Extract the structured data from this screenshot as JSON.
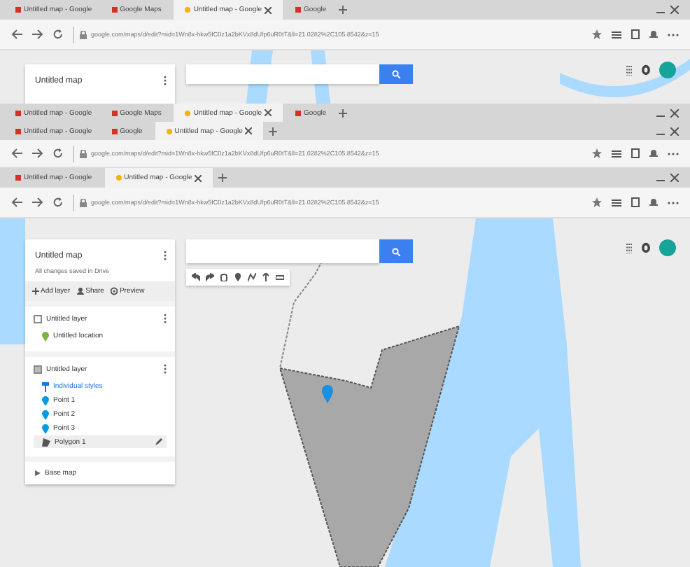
{
  "windows": [
    {
      "tabs": [
        {
          "label": "Untitled map - Google",
          "selected": false
        },
        {
          "label": "Google Maps",
          "selected": false
        },
        {
          "label": "Untitled map - Google",
          "selected": true
        },
        {
          "label": "Google",
          "selected": false
        }
      ],
      "url": "google.com/maps/d/edit?mid=1Wn8x-hkw5fC0z1a2bKVx8dUfp6uR0tT&ll=21.0282%2C105.8542&z=15",
      "map": {
        "panel_title": "Untitled map"
      }
    },
    {
      "tabs": [
        {
          "label": "Untitled map - Google",
          "selected": false
        },
        {
          "label": "Google Maps",
          "selected": false
        },
        {
          "label": "Untitled map - Google",
          "selected": true
        },
        {
          "label": "Google",
          "selected": false
        }
      ]
    },
    {
      "tabs": [
        {
          "label": "Untitled map - Google",
          "selected": false
        },
        {
          "label": "Google",
          "selected": false
        },
        {
          "label": "Untitled map - Google",
          "selected": true
        }
      ],
      "url": "google.com/maps/d/edit?mid=1Wn8x-hkw5fC0z1a2bKVx8dUfp6uR0tT&ll=21.0282%2C105.8542&z=15"
    },
    {
      "tabs": [
        {
          "label": "Untitled map - Google",
          "selected": false
        },
        {
          "label": "Untitled map - Google",
          "selected": true
        }
      ],
      "url": "google.com/maps/d/edit?mid=1Wn8x-hkw5fC0z1a2bKVx8dUfp6uR0tT&ll=21.0282%2C105.8542&z=15",
      "map": {
        "panel_title": "Untitled map",
        "description": "All changes saved in Drive",
        "actions": [
          "Add layer",
          "Share",
          "Preview"
        ],
        "layers": [
          {
            "name": "Untitled layer",
            "checked": false,
            "items": [
              {
                "kind": "place",
                "label": "Untitled location",
                "color": "#7cb342",
                "selected": false
              }
            ]
          },
          {
            "name": "Untitled layer",
            "checked": true,
            "items": [
              {
                "kind": "style",
                "label": "Individual styles",
                "selected": false
              },
              {
                "kind": "place",
                "label": "Point 1",
                "color": "#039be5",
                "selected": false
              },
              {
                "kind": "place",
                "label": "Point 2",
                "color": "#039be5",
                "selected": false
              },
              {
                "kind": "place",
                "label": "Point 3",
                "color": "#039be5",
                "selected": false
              },
              {
                "kind": "shape",
                "label": "Polygon 1",
                "selected": true
              }
            ]
          }
        ],
        "base_map": "Base map"
      }
    }
  ]
}
